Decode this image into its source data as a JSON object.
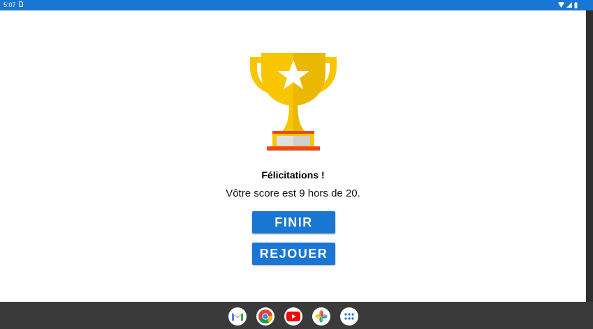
{
  "status_bar": {
    "time": "5:07"
  },
  "dialog": {
    "title": "Félicitations !",
    "message": "Vôtre score est 9 hors de 20.",
    "score": 9,
    "total": 20
  },
  "buttons": {
    "finish": "FINIR",
    "replay": "REJOUER"
  },
  "dock": {
    "apps": [
      "gmail-icon",
      "chrome-icon",
      "youtube-icon",
      "photos-icon",
      "app-drawer-icon"
    ]
  },
  "colors": {
    "accent": "#1976d2",
    "trophy_gold": "#f7c600",
    "trophy_dark": "#e0a800",
    "trophy_base_red": "#e84a1c"
  }
}
